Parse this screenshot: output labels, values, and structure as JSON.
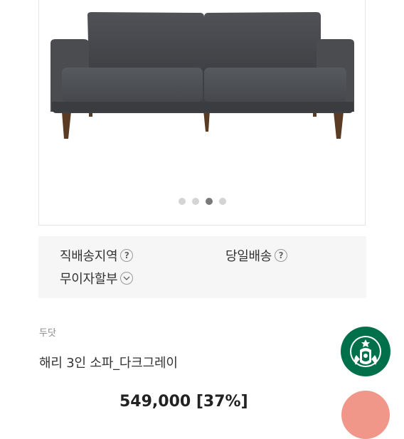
{
  "gallery": {
    "image_alt": "sofa-image",
    "dot_count": 4,
    "active_index": 2
  },
  "info": {
    "direct_delivery": "직배송지역",
    "same_day": "당일배송",
    "installment": "무이자할부",
    "help_symbol": "?"
  },
  "product": {
    "brand": "두닷",
    "title": "해리 3인 소파_다크그레이",
    "price": "549,000 [37%]"
  },
  "colors": {
    "sofa_fabric": "#4c4e52",
    "leg_wood": "#5a3b24",
    "accent_orange": "#f0978a",
    "starbucks_green": "#00704a"
  }
}
